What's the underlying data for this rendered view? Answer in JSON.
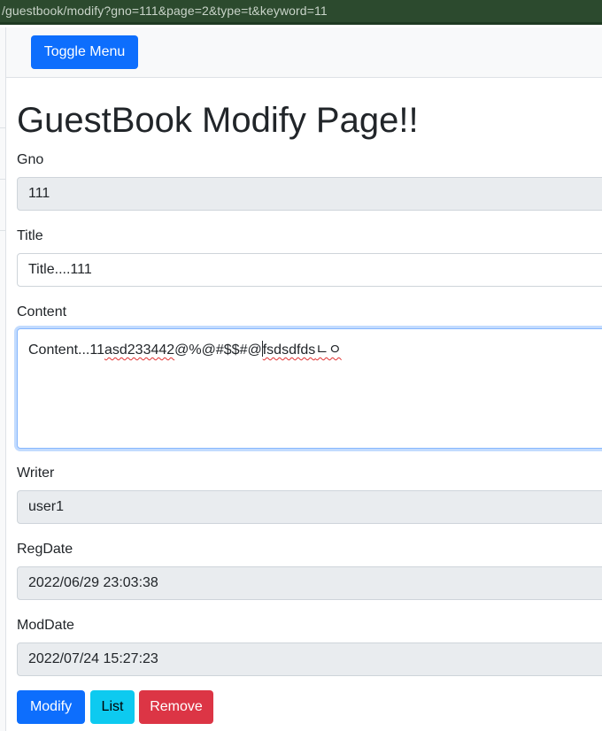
{
  "browser": {
    "url": "/guestbook/modify?gno=111&page=2&type=t&keyword=11"
  },
  "navbar": {
    "toggle_label": "Toggle Menu"
  },
  "page": {
    "title": "GuestBook Modify Page!!"
  },
  "form": {
    "gno": {
      "label": "Gno",
      "value": "111"
    },
    "title": {
      "label": "Title",
      "value": "Title....111"
    },
    "content": {
      "label": "Content",
      "part1": "Content...11",
      "part2": "asd233442",
      "part3": "@%@#$$#@",
      "part4": "fsdsdfds",
      "part5": "ㄴㅇ"
    },
    "writer": {
      "label": "Writer",
      "value": "user1"
    },
    "regdate": {
      "label": "RegDate",
      "value": "2022/06/29 23:03:38"
    },
    "moddate": {
      "label": "ModDate",
      "value": "2022/07/24 15:27:23"
    }
  },
  "actions": {
    "modify_label": "Modify",
    "list_label": "List",
    "remove_label": "Remove"
  },
  "colors": {
    "primary": "#0d6efd",
    "info": "#0dcaf0",
    "danger": "#dc3545",
    "readonly_bg": "#e9ecef",
    "browser_bar": "#2c4a2e"
  }
}
